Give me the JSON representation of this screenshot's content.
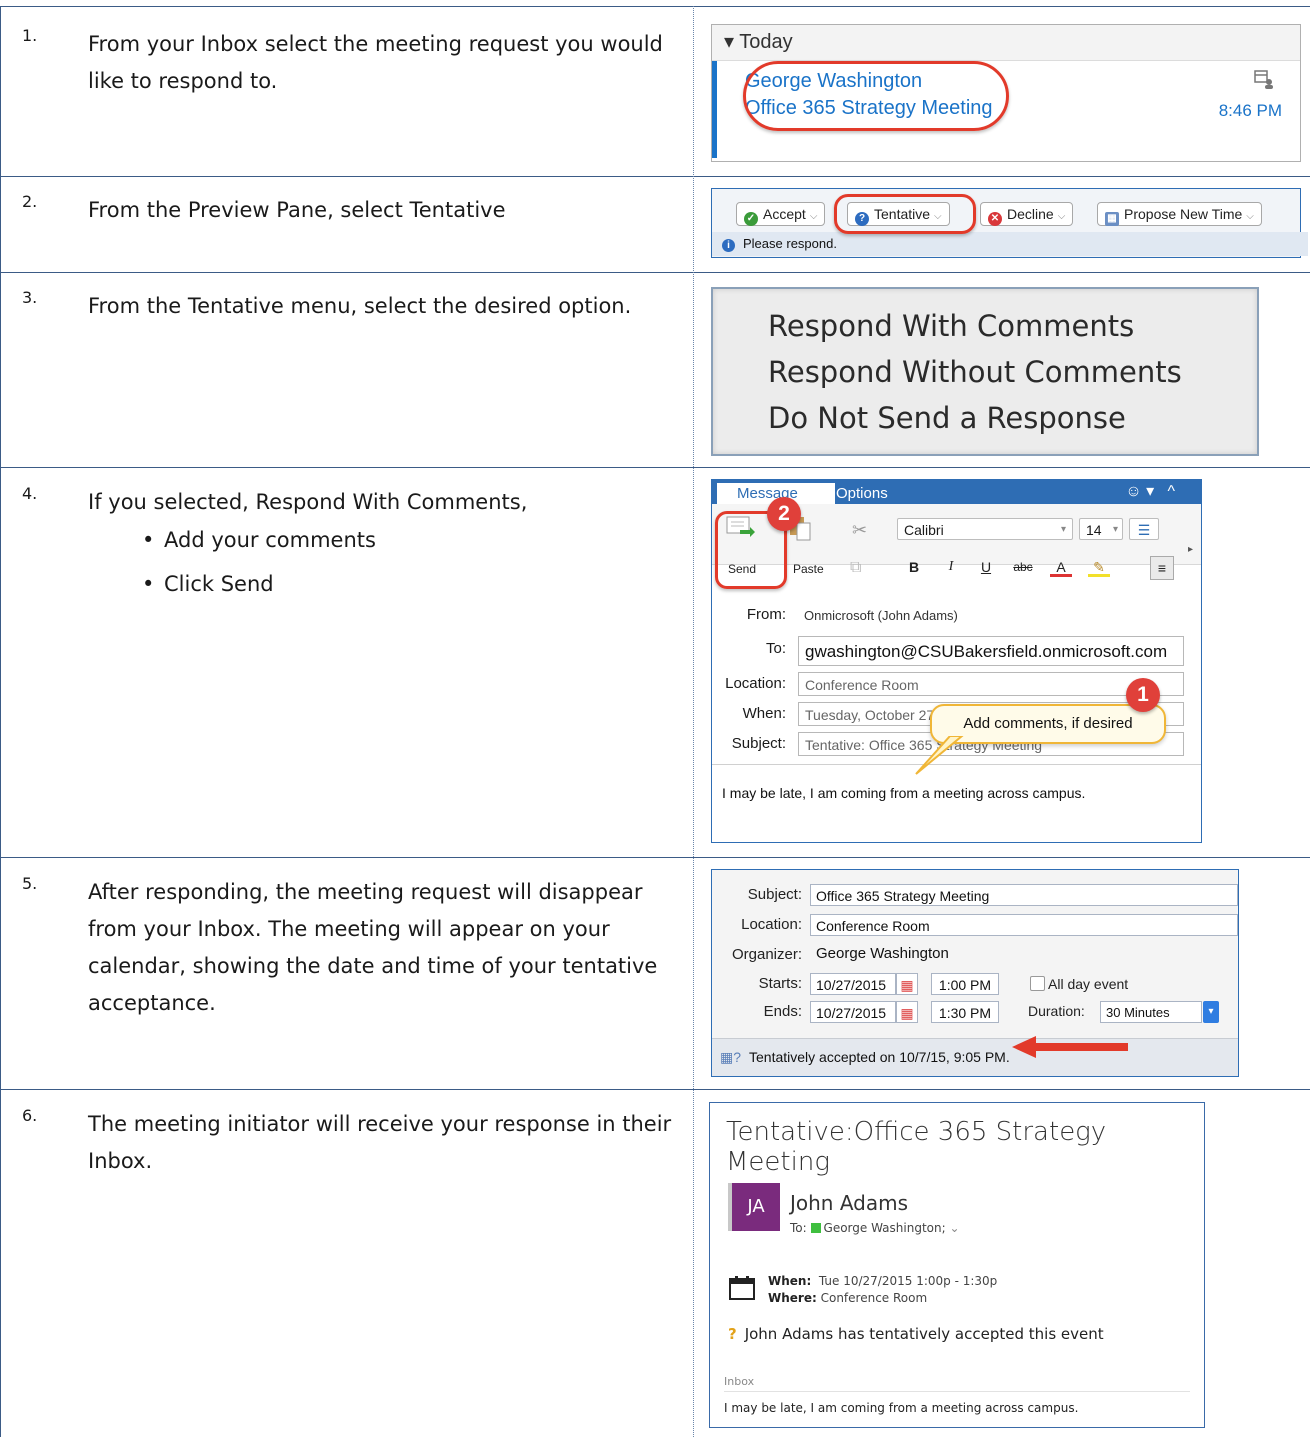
{
  "steps": [
    {
      "num": "1.",
      "text": "From your Inbox select the meeting request you would like to respond to."
    },
    {
      "num": "2.",
      "text": "From the Preview Pane, select Tentative"
    },
    {
      "num": "3.",
      "text": "From the Tentative menu, select the desired option."
    },
    {
      "num": "4.",
      "text": "If you selected, Respond With Comments,",
      "bullets": [
        "Add your comments",
        "Click Send"
      ]
    },
    {
      "num": "5.",
      "text": "After responding, the meeting request will disappear from your Inbox. The meeting will appear on your calendar, showing the date and time of your tentative acceptance."
    },
    {
      "num": "6.",
      "text": "The meeting initiator will receive your response in their Inbox."
    }
  ],
  "inbox": {
    "group": "▾ Today",
    "sender": "George Washington",
    "subject": "Office 365 Strategy Meeting",
    "time": "8:46 PM"
  },
  "response_bar": {
    "accept": "Accept",
    "tentative": "Tentative",
    "decline": "Decline",
    "propose": "Propose New Time",
    "note": "Please respond."
  },
  "tentative_menu": [
    "Respond With Comments",
    "Respond Without Comments",
    "Do Not Send a Response"
  ],
  "compose": {
    "tab_message": "Message",
    "tab_options": "Options",
    "send": "Send",
    "paste": "Paste",
    "font": "Calibri",
    "size": "14",
    "bold": "B",
    "italic": "I",
    "underline": "U",
    "strike": "abc",
    "from_label": "From:",
    "from_value": "Onmicrosoft (John Adams)",
    "to_label": "To:",
    "to_value": "gwashington@CSUBakersfield.onmicrosoft.com",
    "location_label": "Location:",
    "location_value": "Conference Room",
    "when_label": "When:",
    "when_value": "Tuesday, October 27",
    "subject_label": "Subject:",
    "subject_value": "Tentative: Office 365 Strategy Meeting",
    "body": "I may be late, I am coming from a meeting across campus.",
    "badge_send": "2",
    "badge_comment": "1",
    "callout": "Add comments, if desired"
  },
  "calendar_item": {
    "subject_label": "Subject:",
    "subject": "Office 365 Strategy Meeting",
    "location_label": "Location:",
    "location": "Conference Room",
    "organizer_label": "Organizer:",
    "organizer": "George Washington",
    "starts_label": "Starts:",
    "start_date": "10/27/2015",
    "start_time": "1:00 PM",
    "ends_label": "Ends:",
    "end_date": "10/27/2015",
    "end_time": "1:30 PM",
    "all_day": "All day event",
    "duration_label": "Duration:",
    "duration": "30 Minutes",
    "status": "Tentatively accepted on 10/7/15, 9:05 PM."
  },
  "reply": {
    "title": "Tentative:Office 365 Strategy Meeting",
    "initials": "JA",
    "name": "John Adams",
    "to_label": "To:",
    "to": "George Washington;",
    "when_label": "When:",
    "when": "Tue 10/27/2015 1:00p - 1:30p",
    "where_label": "Where:",
    "where": "Conference Room",
    "status": "John Adams has tentatively accepted this event",
    "folder": "Inbox",
    "message": "I may be late, I am coming from a meeting across campus."
  },
  "colors": {
    "accent": "#2e6db4",
    "highlight": "#e23a2a",
    "link": "#1a73c8",
    "avatar": "#7a2b7d"
  }
}
